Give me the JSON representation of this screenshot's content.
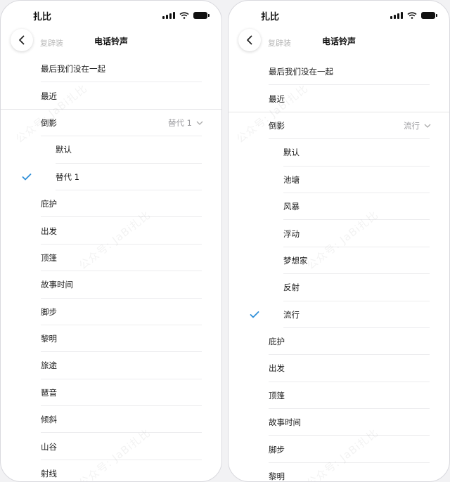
{
  "left": {
    "status_time": "扎比",
    "nav_title": "电话铃声",
    "faded_header": "复辟装",
    "rows": [
      {
        "label": "最后我们没在一起"
      },
      {
        "label": "最近"
      },
      {
        "label": "倒影",
        "trail": "替代 1"
      },
      {
        "label": "默认"
      },
      {
        "label": "替代 1"
      },
      {
        "label": "庇护"
      },
      {
        "label": "出发"
      },
      {
        "label": "顶篷"
      },
      {
        "label": "故事时间"
      },
      {
        "label": "脚步"
      },
      {
        "label": "黎明"
      },
      {
        "label": "旅途"
      },
      {
        "label": "琶音"
      },
      {
        "label": "倾斜"
      },
      {
        "label": "山谷"
      },
      {
        "label": "射线"
      }
    ]
  },
  "right": {
    "status_time": "扎比",
    "nav_title": "电话铃声",
    "faded_header": "复辟装",
    "rows": [
      {
        "label": "最后我们没在一起"
      },
      {
        "label": "最近"
      },
      {
        "label": "倒影",
        "trail": "流行"
      },
      {
        "label": "默认"
      },
      {
        "label": "池塘"
      },
      {
        "label": "风暴"
      },
      {
        "label": "浮动"
      },
      {
        "label": "梦想家"
      },
      {
        "label": "反射"
      },
      {
        "label": "流行"
      },
      {
        "label": "庇护"
      },
      {
        "label": "出发"
      },
      {
        "label": "顶篷"
      },
      {
        "label": "故事时间"
      },
      {
        "label": "脚步"
      },
      {
        "label": "黎明"
      }
    ]
  },
  "watermark": "公众号: JaBi扎比",
  "colors": {
    "check": "#2f8fd8",
    "divider": "#ececee",
    "back_shadow": "#bdbdbd"
  }
}
